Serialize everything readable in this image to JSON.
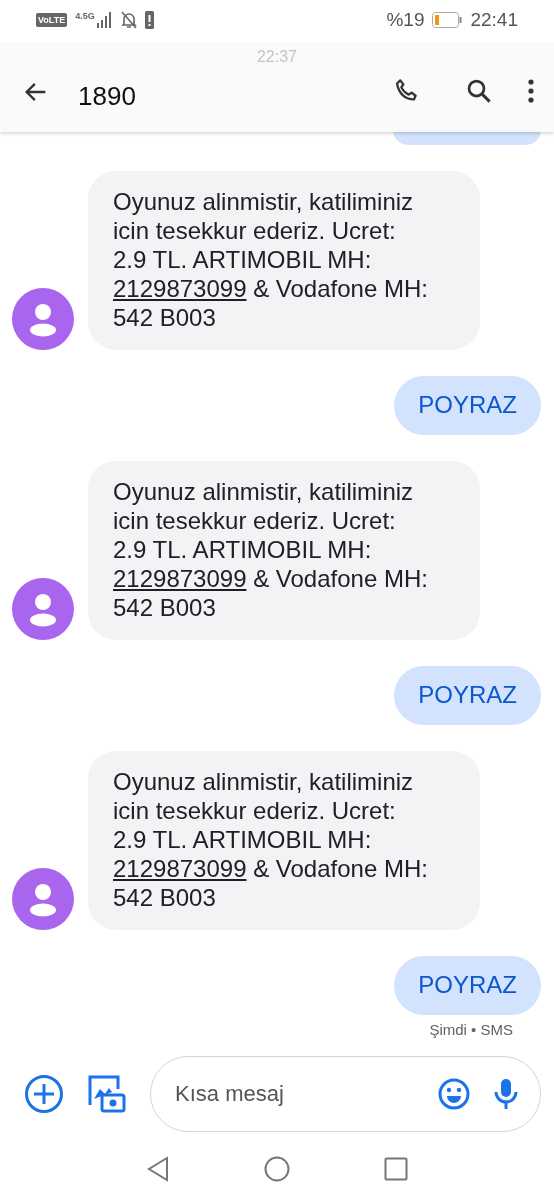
{
  "status_bar": {
    "volte_badge": "VoLTE",
    "network_type": "4.5G",
    "battery_text": "%19",
    "time": "22:41"
  },
  "header": {
    "title": "1890"
  },
  "conversation": {
    "time_divider": "22:37",
    "messages": [
      {
        "kind": "cut_sent"
      },
      {
        "kind": "received",
        "parts": [
          {
            "kind": "plain",
            "text": "Oyunuz alinmistir, katiliminiz icin tesekkur ederiz. Ucret: 2.9 TL. ARTIMOBIL MH: "
          },
          {
            "kind": "link",
            "text": "2129873099"
          },
          {
            "kind": "plain",
            "text": " & Vodafone MH: 542 B003"
          }
        ]
      },
      {
        "kind": "sent",
        "text": "POYRAZ"
      },
      {
        "kind": "received",
        "parts": [
          {
            "kind": "plain",
            "text": "Oyunuz alinmistir, katiliminiz icin tesekkur ederiz. Ucret: 2.9 TL. ARTIMOBIL MH: "
          },
          {
            "kind": "link",
            "text": "2129873099"
          },
          {
            "kind": "plain",
            "text": " & Vodafone MH: 542 B003"
          }
        ]
      },
      {
        "kind": "sent",
        "text": "POYRAZ"
      },
      {
        "kind": "received",
        "parts": [
          {
            "kind": "plain",
            "text": "Oyunuz alinmistir, katiliminiz icin tesekkur ederiz. Ucret: 2.9 TL. ARTIMOBIL MH: "
          },
          {
            "kind": "link",
            "text": "2129873099"
          },
          {
            "kind": "plain",
            "text": " & Vodafone MH: 542 B003"
          }
        ]
      },
      {
        "kind": "sent",
        "text": "POYRAZ",
        "meta": "Şimdi • SMS"
      }
    ]
  },
  "composer": {
    "placeholder": "Kısa mesaj"
  }
}
